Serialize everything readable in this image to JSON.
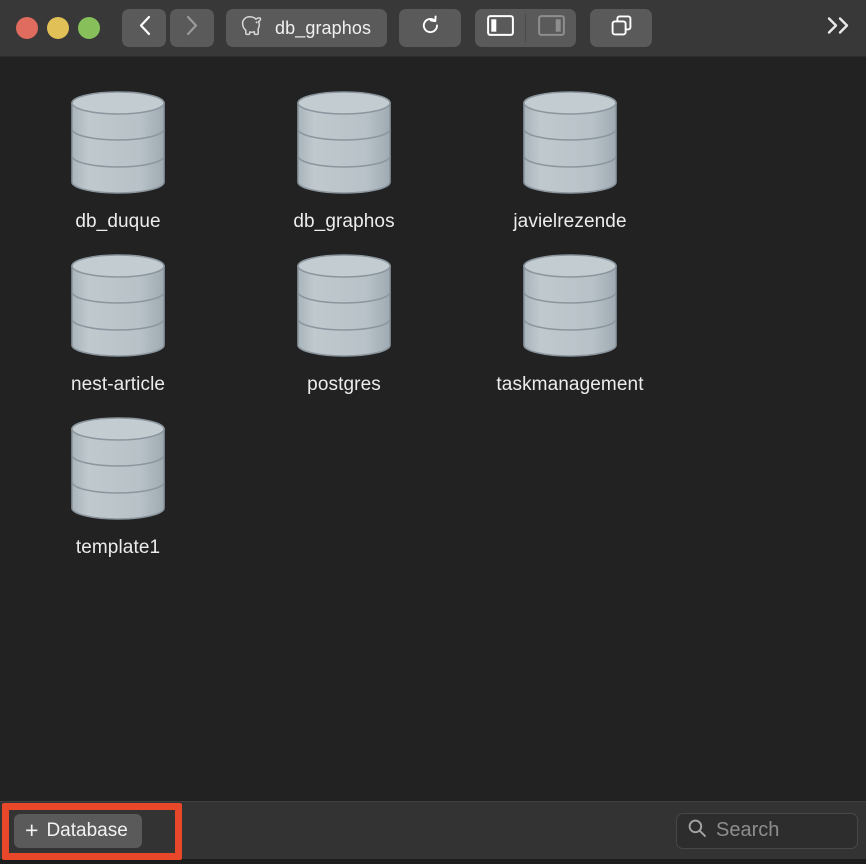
{
  "window": {
    "traffic_lights": [
      {
        "name": "close",
        "color": "#e06c5f"
      },
      {
        "name": "minimize",
        "color": "#e0c057"
      },
      {
        "name": "maximize",
        "color": "#87c05a"
      }
    ]
  },
  "toolbar": {
    "back_label": "‹",
    "forward_label": "›",
    "title": "db_graphos",
    "title_icon": "elephant-icon",
    "refresh_icon": "refresh-icon",
    "sidebar_left_icon": "sidebar-left-icon",
    "sidebar_right_icon": "sidebar-right-icon",
    "duplicate_icon": "duplicate-windows-icon",
    "overflow_label": "»"
  },
  "content": {
    "databases": [
      {
        "label": "db_duque"
      },
      {
        "label": "db_graphos"
      },
      {
        "label": "javielrezende"
      },
      {
        "label": "nest-article"
      },
      {
        "label": "postgres"
      },
      {
        "label": "taskmanagement"
      },
      {
        "label": "template1"
      }
    ]
  },
  "bottombar": {
    "add_database_plus": "+",
    "add_database_label": "Database",
    "search_placeholder": "Search",
    "search_value": "",
    "search_icon": "search-icon"
  },
  "colors": {
    "highlight": "#e8472a",
    "toolbar_bg": "#383838",
    "content_bg": "#222222",
    "bottombar_bg": "#333333",
    "db_icon_fill": "#b9c3c9"
  }
}
